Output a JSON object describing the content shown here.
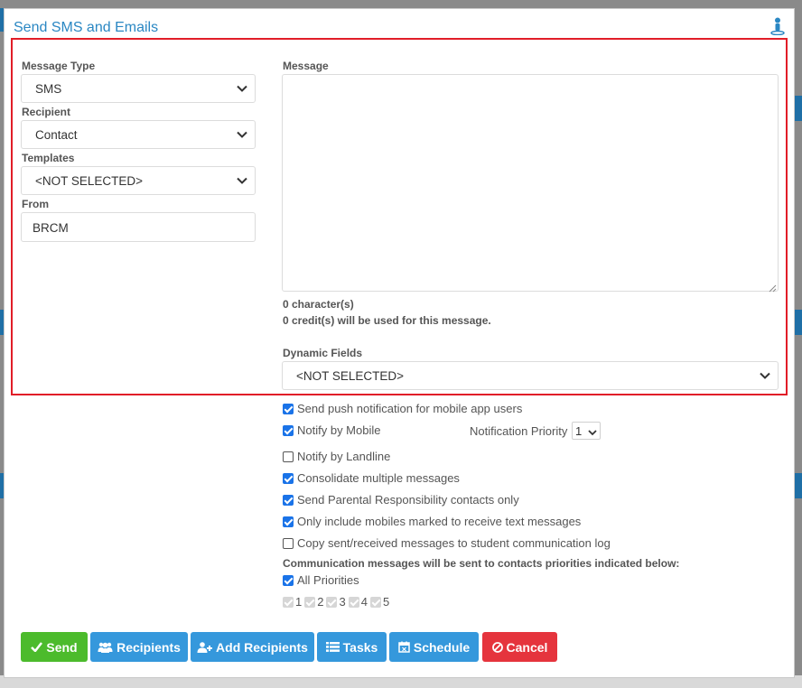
{
  "modal": {
    "title": "Send SMS and Emails"
  },
  "form": {
    "message_type": {
      "label": "Message Type",
      "value": "SMS"
    },
    "recipient": {
      "label": "Recipient",
      "value": "Contact"
    },
    "templates": {
      "label": "Templates",
      "value": "<NOT SELECTED>"
    },
    "from": {
      "label": "From",
      "value": "BRCM"
    },
    "message": {
      "label": "Message",
      "value": ""
    },
    "char_count": "0 character(s)",
    "credit_info": "0 credit(s) will be used for this message.",
    "dynamic_fields": {
      "label": "Dynamic Fields",
      "value": "<NOT SELECTED>"
    }
  },
  "options": {
    "push_notification": {
      "label": "Send push notification for mobile app users",
      "checked": true
    },
    "notify_mobile": {
      "label": "Notify by Mobile",
      "checked": true
    },
    "notification_priority": {
      "label": "Notification Priority",
      "value": "1"
    },
    "notify_landline": {
      "label": "Notify by Landline",
      "checked": false
    },
    "consolidate": {
      "label": "Consolidate multiple messages",
      "checked": true
    },
    "parental_only": {
      "label": "Send Parental Responsibility contacts only",
      "checked": true
    },
    "only_mobiles": {
      "label": "Only include mobiles marked to receive text messages",
      "checked": true
    },
    "copy_log": {
      "label": "Copy sent/received messages to student communication log",
      "checked": false
    },
    "priorities_note": "Communication messages will be sent to contacts priorities indicated below:",
    "all_priorities": {
      "label": "All Priorities",
      "checked": true
    },
    "priorities": [
      "1",
      "2",
      "3",
      "4",
      "5"
    ]
  },
  "buttons": {
    "send": "Send",
    "recipients": "Recipients",
    "add_recipients": "Add Recipients",
    "tasks": "Tasks",
    "schedule": "Schedule",
    "cancel": "Cancel"
  },
  "colors": {
    "title": "#2a87c3",
    "highlight_border": "#e11d28",
    "checkbox": "#1a73e8",
    "send": "#4cbb2c",
    "primary": "#3598dc",
    "cancel": "#e5343d"
  },
  "icons": {
    "help": "person-help-icon",
    "send": "check-icon",
    "recipients": "users-icon",
    "add_recipients": "user-plus-icon",
    "tasks": "list-icon",
    "schedule": "calendar-icon",
    "cancel": "ban-icon"
  }
}
